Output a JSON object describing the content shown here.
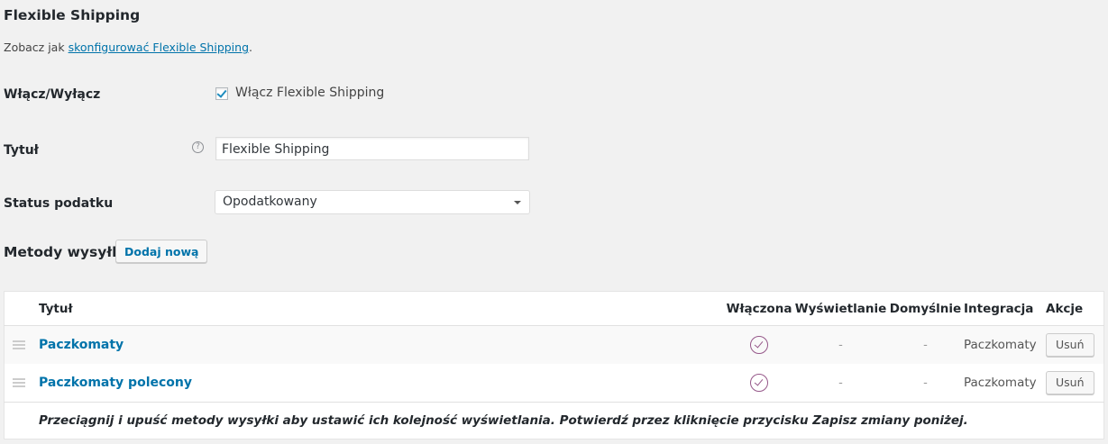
{
  "header": {
    "title": "Flexible Shipping",
    "intro_text": "Zobacz jak ",
    "intro_link": "skonfigurować Flexible Shipping",
    "intro_suffix": "."
  },
  "settings": {
    "enable": {
      "label": "Włącz/Wyłącz",
      "checkbox_label": "Włącz Flexible Shipping",
      "checked": true
    },
    "title": {
      "label": "Tytuł",
      "help_icon": "?",
      "value": "Flexible Shipping"
    },
    "tax_status": {
      "label": "Status podatku",
      "selected": "Opodatkowany"
    }
  },
  "methods": {
    "section_title": "Metody wysyłki",
    "add_new_label": "Dodaj nową",
    "columns": {
      "title": "Tytuł",
      "enabled": "Włączona",
      "display": "Wyświetlanie",
      "default": "Domyślnie",
      "integration": "Integracja",
      "actions": "Akcje"
    },
    "rows": [
      {
        "title": "Paczkomaty",
        "enabled": true,
        "display": "-",
        "default": "-",
        "integration": "Paczkomaty",
        "remove_label": "Usuń"
      },
      {
        "title": "Paczkomaty polecony",
        "enabled": true,
        "display": "-",
        "default": "-",
        "integration": "Paczkomaty",
        "remove_label": "Usuń"
      }
    ],
    "footer_note": "Przeciągnij i upuść metody wysyłki aby ustawić ich kolejność wyświetlania. Potwierdź przez kliknięcie przycisku Zapisz zmiany poniżej."
  },
  "colors": {
    "link": "#0073aa",
    "check_icon": "#96588a",
    "background": "#f1f1f1"
  },
  "icons": {
    "help": "question-circle-icon",
    "enabled": "check-circle-icon",
    "drag": "drag-handle-icon",
    "select": "chevron-down-icon"
  }
}
